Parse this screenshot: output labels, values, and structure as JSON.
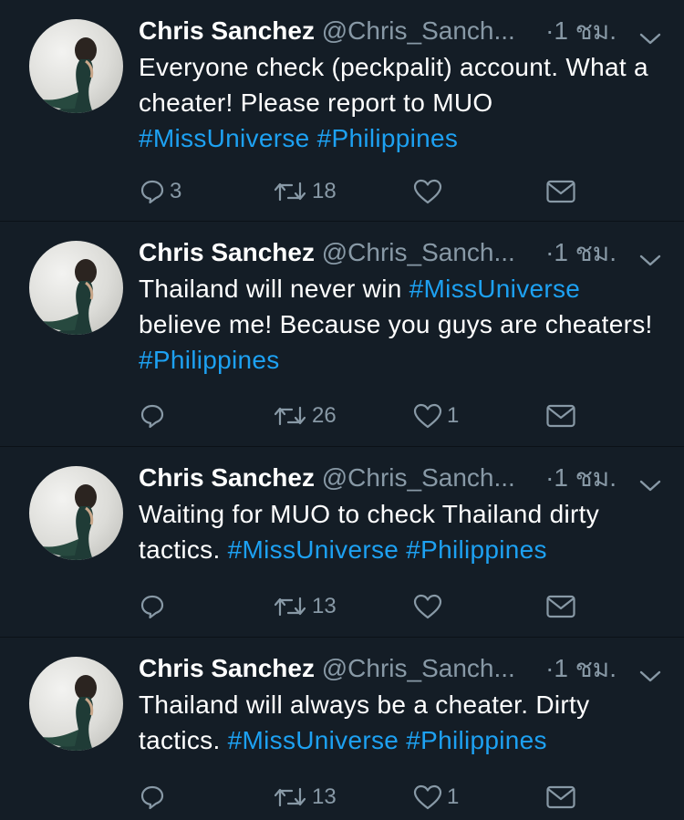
{
  "tweets": [
    {
      "name": "Chris Sanchez",
      "handle": "@Chris_Sanch...",
      "time": "·1 ชม.",
      "segments": [
        {
          "text": "Everyone check (peckpalit) account. What a cheater! Please report to MUO ",
          "tag": false
        },
        {
          "text": "#MissUniverse",
          "tag": true
        },
        {
          "text": " ",
          "tag": false
        },
        {
          "text": "#Philippines",
          "tag": true
        }
      ],
      "replies": "3",
      "retweets": "18",
      "likes": ""
    },
    {
      "name": "Chris Sanchez",
      "handle": "@Chris_Sanch...",
      "time": "·1 ชม.",
      "segments": [
        {
          "text": "Thailand will never win ",
          "tag": false
        },
        {
          "text": "#MissUniverse",
          "tag": true
        },
        {
          "text": " believe me! Because you guys are cheaters! ",
          "tag": false
        },
        {
          "text": "#Philippines",
          "tag": true
        }
      ],
      "replies": "",
      "retweets": "26",
      "likes": "1"
    },
    {
      "name": "Chris Sanchez",
      "handle": "@Chris_Sanch...",
      "time": "·1 ชม.",
      "segments": [
        {
          "text": "Waiting for MUO to check Thailand dirty tactics. ",
          "tag": false
        },
        {
          "text": "#MissUniverse",
          "tag": true
        },
        {
          "text": " ",
          "tag": false
        },
        {
          "text": "#Philippines",
          "tag": true
        }
      ],
      "replies": "",
      "retweets": "13",
      "likes": ""
    },
    {
      "name": "Chris Sanchez",
      "handle": "@Chris_Sanch...",
      "time": "·1 ชม.",
      "segments": [
        {
          "text": "Thailand will always be a cheater. Dirty tactics. ",
          "tag": false
        },
        {
          "text": "#MissUniverse",
          "tag": true
        },
        {
          "text": " ",
          "tag": false
        },
        {
          "text": "#Philippines",
          "tag": true
        }
      ],
      "replies": "",
      "retweets": "13",
      "likes": "1"
    }
  ],
  "colors": {
    "background": "#141d26",
    "text": "#ffffff",
    "muted": "#8899a6",
    "hashtag": "#1da1f2"
  },
  "icons": [
    "reply-icon",
    "retweet-icon",
    "like-icon",
    "message-icon",
    "chevron-down-icon"
  ]
}
